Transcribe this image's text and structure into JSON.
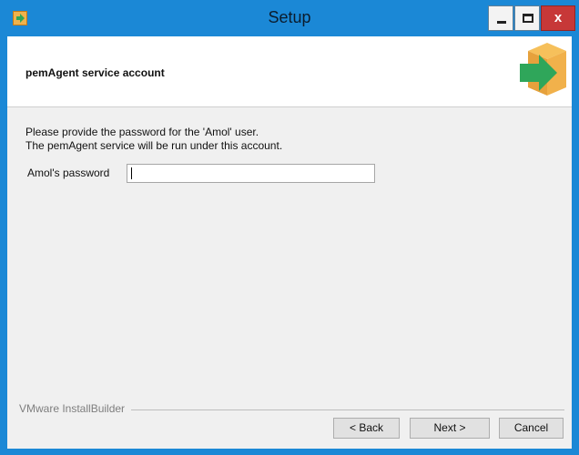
{
  "window": {
    "title": "Setup",
    "close_label": "x",
    "colors": {
      "titlebar": "#1b88d6",
      "close": "#c73838"
    }
  },
  "header": {
    "title": "pemAgent service account"
  },
  "body": {
    "description_line1": "Please provide the password for the 'Amol' user.",
    "description_line2": "The pemAgent service will be run under this account.",
    "password_label": "Amol's password",
    "password_value": ""
  },
  "footer": {
    "brand": "VMware InstallBuilder",
    "back_label": "< Back",
    "next_label": "Next >",
    "cancel_label": "Cancel"
  }
}
